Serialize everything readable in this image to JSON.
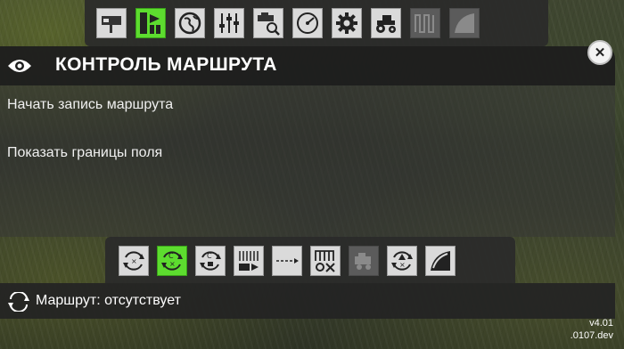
{
  "top_toolbar": {
    "icons": [
      {
        "name": "course-manager-icon",
        "state": "normal"
      },
      {
        "name": "steering-flow-icon",
        "state": "active"
      },
      {
        "name": "globe-icon",
        "state": "normal"
      },
      {
        "name": "sliders-icon",
        "state": "normal"
      },
      {
        "name": "combine-search-icon",
        "state": "normal"
      },
      {
        "name": "speedometer-icon",
        "state": "normal"
      },
      {
        "name": "gear-icon",
        "state": "normal"
      },
      {
        "name": "tractor-icon",
        "state": "normal"
      },
      {
        "name": "field-pattern-icon",
        "state": "dim"
      },
      {
        "name": "field-edge-icon",
        "state": "dim"
      }
    ]
  },
  "header": {
    "title": "КОНТРОЛЬ МАРШРУТА"
  },
  "menu": {
    "items": [
      {
        "label": "Начать запись маршрута"
      },
      {
        "label": "Показать границы поля"
      }
    ]
  },
  "bottom_toolbar": {
    "icons": [
      {
        "name": "route-cycle-icon",
        "state": "normal"
      },
      {
        "name": "route-cycle-record-icon",
        "state": "active"
      },
      {
        "name": "route-cycle-stop-icon",
        "state": "normal"
      },
      {
        "name": "headland-icon",
        "state": "normal"
      },
      {
        "name": "route-line-icon",
        "state": "normal"
      },
      {
        "name": "field-work-tools-icon",
        "state": "normal"
      },
      {
        "name": "combine-icon",
        "state": "dim"
      },
      {
        "name": "route-cycle-alert-icon",
        "state": "normal"
      },
      {
        "name": "field-edge-curve-icon",
        "state": "normal"
      }
    ]
  },
  "status": {
    "route_text": "Маршрут: отсутствует"
  },
  "version": {
    "line1": "v4.01",
    "line2": ".0107.dev"
  },
  "colors": {
    "active": "#5ddc2f",
    "button": "#dadada",
    "dim_button": "#5b5b5b",
    "panel_dark": "#1e1e1e"
  }
}
